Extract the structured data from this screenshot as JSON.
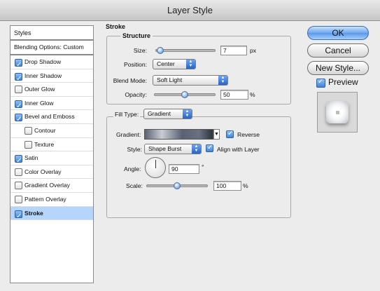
{
  "window": {
    "title": "Layer Style"
  },
  "styles_list": {
    "header": "Styles",
    "blending_options": "Blending Options: Custom",
    "items": [
      {
        "label": "Drop Shadow",
        "checked": true,
        "sub": false
      },
      {
        "label": "Inner Shadow",
        "checked": true,
        "sub": false
      },
      {
        "label": "Outer Glow",
        "checked": false,
        "sub": false
      },
      {
        "label": "Inner Glow",
        "checked": true,
        "sub": false
      },
      {
        "label": "Bevel and Emboss",
        "checked": true,
        "sub": false
      },
      {
        "label": "Contour",
        "checked": false,
        "sub": true
      },
      {
        "label": "Texture",
        "checked": false,
        "sub": true
      },
      {
        "label": "Satin",
        "checked": true,
        "sub": false
      },
      {
        "label": "Color Overlay",
        "checked": false,
        "sub": false
      },
      {
        "label": "Gradient Overlay",
        "checked": false,
        "sub": false
      },
      {
        "label": "Pattern Overlay",
        "checked": false,
        "sub": false
      },
      {
        "label": "Stroke",
        "checked": true,
        "sub": false,
        "selected": true
      }
    ]
  },
  "stroke": {
    "title": "Stroke",
    "structure_title": "Structure",
    "size_label": "Size:",
    "size_value": "7",
    "size_unit": "px",
    "size_slider": 0.03,
    "position_label": "Position:",
    "position_value": "Center",
    "blend_mode_label": "Blend Mode:",
    "blend_mode_value": "Soft Light",
    "opacity_label": "Opacity:",
    "opacity_value": "50",
    "opacity_unit": "%",
    "opacity_slider": 0.5
  },
  "fill": {
    "fill_type_label": "Fill Type:",
    "fill_type_value": "Gradient",
    "gradient_label": "Gradient:",
    "reverse_label": "Reverse",
    "reverse_checked": true,
    "style_label": "Style:",
    "style_value": "Shape Burst",
    "align_label": "Align with Layer",
    "align_checked": true,
    "angle_label": "Angle:",
    "angle_value": "90",
    "angle_unit": "°",
    "scale_label": "Scale:",
    "scale_value": "100",
    "scale_unit": "%",
    "scale_slider": 0.5
  },
  "buttons": {
    "ok": "OK",
    "cancel": "Cancel",
    "new_style": "New Style...",
    "preview_label": "Preview",
    "preview_checked": true
  }
}
